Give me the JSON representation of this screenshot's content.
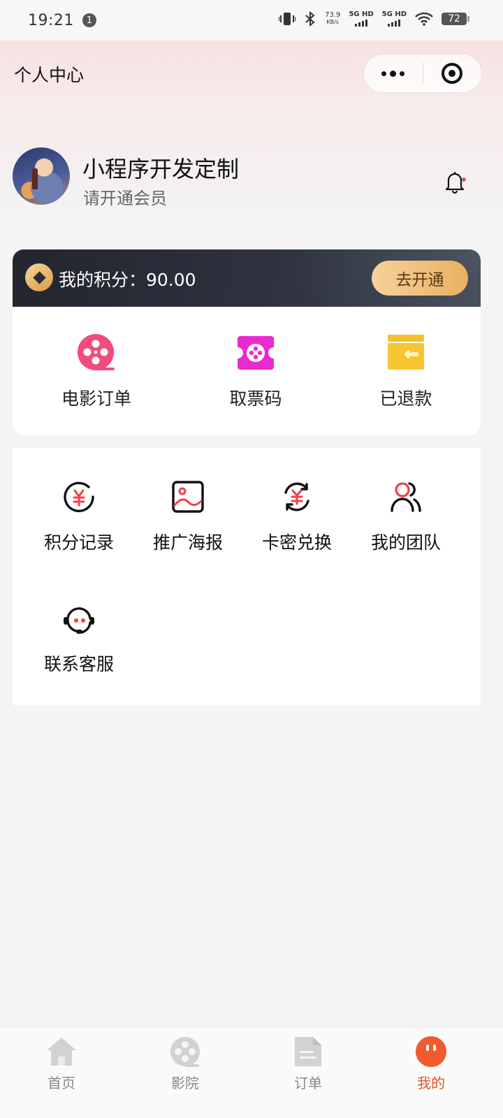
{
  "status_bar": {
    "time": "19:21",
    "notification_count": "1",
    "net_speed_value": "73.9",
    "net_speed_unit": "KB/s",
    "signal_1": "5G HD",
    "signal_2": "5G HD",
    "battery": "72"
  },
  "nav": {
    "title": "个人中心",
    "more_icon": "more-dots-icon",
    "close_icon": "target-circle-icon"
  },
  "user": {
    "name": "小程序开发定制",
    "subtitle": "请开通会员",
    "bell_icon": "bell-icon"
  },
  "points": {
    "label": "我的积分：90.00",
    "button": "去开通",
    "accent": "#f2c27e"
  },
  "orders": [
    {
      "label": "电影订单",
      "icon": "film-reel-icon",
      "color": "#f34b7a"
    },
    {
      "label": "取票码",
      "icon": "ticket-icon",
      "color": "#e92ad0"
    },
    {
      "label": "已退款",
      "icon": "refund-card-icon",
      "color": "#f7c531"
    }
  ],
  "services": [
    {
      "label": "积分记录",
      "icon": "points-record-icon"
    },
    {
      "label": "推广海报",
      "icon": "poster-icon"
    },
    {
      "label": "卡密兑换",
      "icon": "exchange-icon"
    },
    {
      "label": "我的团队",
      "icon": "team-icon"
    },
    {
      "label": "联系客服",
      "icon": "customer-service-icon"
    }
  ],
  "tabbar": {
    "items": [
      {
        "label": "首页",
        "icon": "home-icon"
      },
      {
        "label": "影院",
        "icon": "cinema-reel-icon"
      },
      {
        "label": "订单",
        "icon": "order-doc-icon"
      },
      {
        "label": "我的",
        "icon": "profile-face-icon"
      }
    ],
    "active_color": "#e2552a"
  }
}
